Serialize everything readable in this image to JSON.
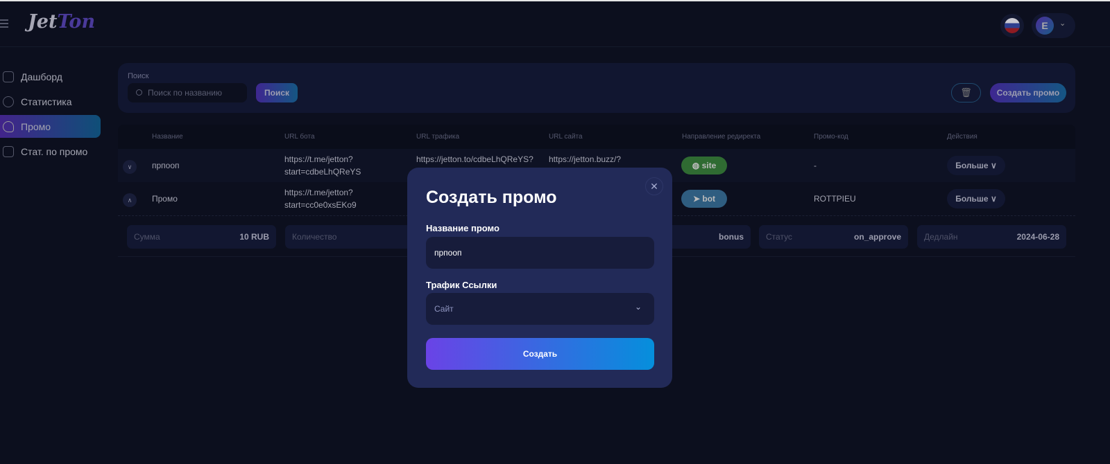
{
  "header": {
    "logo_a": "Jet",
    "logo_b": "Ton",
    "avatar_letter": "E"
  },
  "sidebar": {
    "items": [
      {
        "label": "Дашборд"
      },
      {
        "label": "Статистика"
      },
      {
        "label": "Промо",
        "active": true
      },
      {
        "label": "Стат. по промо"
      }
    ]
  },
  "search": {
    "label": "Поиск",
    "placeholder": "Поиск по названию",
    "button": "Поиск",
    "create_button": "Создать промо"
  },
  "table": {
    "columns": [
      "Название",
      "URL бота",
      "URL трафика",
      "URL сайта",
      "Направление редиректа",
      "Промо-код",
      "Действия"
    ],
    "rows": [
      {
        "name": "прпооп",
        "bot_url": [
          "https://t.me/jetton?",
          "start=cdbeLhQReYS"
        ],
        "traffic_url": "https://jetton.to/cdbeLhQReYS?",
        "site_url": "https://jetton.buzz/?",
        "redirect": "site",
        "redirect_color": "#2f6b32",
        "promo_code": "-",
        "action": "Больше"
      },
      {
        "name": "Промо",
        "bot_url": [
          "https://t.me/jetton?",
          "start=cc0e0xsEKo9"
        ],
        "traffic_url": "",
        "site_url": "",
        "redirect": "bot",
        "redirect_color": "#2f5d80",
        "promo_code": "ROTTPIEU",
        "action": "Больше"
      }
    ],
    "details": [
      {
        "label": "Сумма",
        "value": "10 RUB"
      },
      {
        "label": "Количество",
        "value": ""
      },
      {
        "label": "",
        "value": ""
      },
      {
        "label": "",
        "value": "bonus"
      },
      {
        "label": "Статус",
        "value": "on_approve"
      },
      {
        "label": "Дедлайн",
        "value": "2024-06-28"
      }
    ]
  },
  "modal": {
    "title": "Создать промо",
    "name_label": "Название промо",
    "name_value": "прпооп",
    "traffic_label": "Трафик Ссылки",
    "traffic_value": "Сайт",
    "submit": "Создать"
  }
}
